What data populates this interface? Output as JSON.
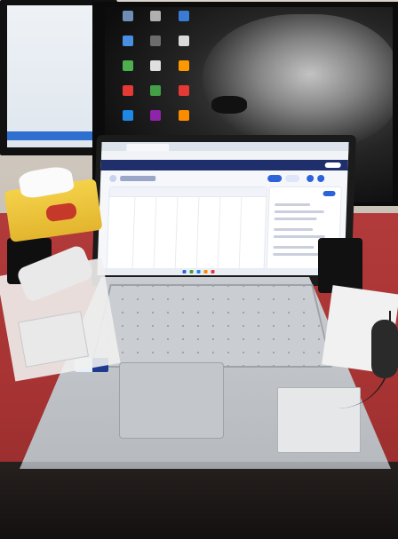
{
  "scene": {
    "browser": {
      "nav_items": [
        "",
        "",
        "",
        "",
        "",
        "",
        "",
        ""
      ]
    },
    "colors": {
      "desk_red": "#a53232",
      "app_navbar": "#1f2f6b",
      "primary_button": "#2b63d9"
    },
    "objects": [
      "left-monitor",
      "right-monitor-lion-wallpaper",
      "laptop",
      "tissue-box",
      "remote-control",
      "papers",
      "mouse"
    ]
  }
}
